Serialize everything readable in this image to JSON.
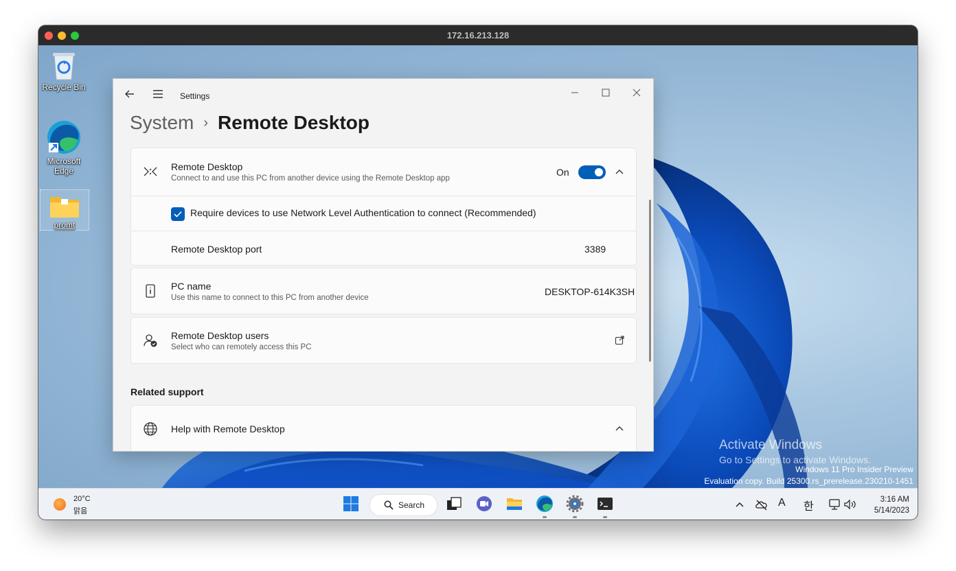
{
  "mac": {
    "title": "172.16.213.128"
  },
  "desktop": {
    "icons": [
      {
        "label": "Recycle Bin"
      },
      {
        "label": "Microsoft Edge"
      },
      {
        "label": "promt"
      }
    ],
    "watermark": {
      "line1": "Activate Windows",
      "line2": "Go to Settings to activate Windows.",
      "build1": "Windows 11 Pro Insider Preview",
      "build2": "Evaluation copy. Build 25300.rs_prerelease.230210-1451"
    }
  },
  "settings": {
    "app_title": "Settings",
    "breadcrumb": {
      "parent": "System",
      "separator": "›",
      "current": "Remote Desktop"
    },
    "remote_desktop": {
      "title": "Remote Desktop",
      "subtitle": "Connect to and use this PC from another device using the Remote Desktop app",
      "toggle_label": "On",
      "toggle_on": true
    },
    "nla": {
      "label": "Require devices to use Network Level Authentication to connect (Recommended)",
      "checked": true
    },
    "port": {
      "label": "Remote Desktop port",
      "value": "3389"
    },
    "pc_name": {
      "title": "PC name",
      "subtitle": "Use this name to connect to this PC from another device",
      "value": "DESKTOP-614K3SH"
    },
    "users": {
      "title": "Remote Desktop users",
      "subtitle": "Select who can remotely access this PC"
    },
    "related_support": {
      "heading": "Related support",
      "help_title": "Help with Remote Desktop"
    },
    "accent_color": "#005fb8"
  },
  "taskbar": {
    "weather": {
      "temp": "20°C",
      "condition": "맑음"
    },
    "search_label": "Search",
    "tray": {
      "font_indicator": "A",
      "ime": "한"
    },
    "clock": {
      "time": "3:16 AM",
      "date": "5/14/2023"
    }
  }
}
